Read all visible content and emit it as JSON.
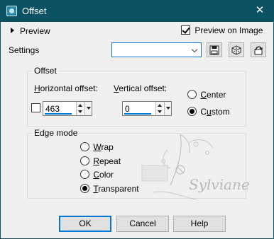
{
  "window": {
    "title": "Offset",
    "close_glyph": "✕",
    "icon": "psp-app-icon"
  },
  "header": {
    "preview_label": "Preview",
    "preview_on_image_label": "Preview on Image",
    "preview_on_image_checked": true
  },
  "settings": {
    "label": "Settings",
    "value": ""
  },
  "offset": {
    "group_label": "Offset",
    "horizontal": {
      "label_first": "H",
      "label_rest": "orizontal offset:",
      "value": "463"
    },
    "vertical": {
      "label_first": "V",
      "label_rest": "ertical offset:",
      "value": "0"
    },
    "link_checked": false,
    "center": {
      "label_first": "C",
      "label_rest": "enter",
      "selected": false
    },
    "custom": {
      "label_first": "",
      "label_u": "u",
      "label_rest": "stom",
      "label_pre": "C",
      "selected": true
    }
  },
  "edge_mode": {
    "group_label": "Edge mode",
    "options": [
      {
        "pre": "",
        "u": "W",
        "rest": "rap",
        "selected": false
      },
      {
        "pre": "",
        "u": "R",
        "rest": "epeat",
        "selected": false
      },
      {
        "pre": "",
        "u": "C",
        "rest": "olor",
        "selected": false
      },
      {
        "pre": "",
        "u": "T",
        "rest": "ransparent",
        "selected": true
      }
    ]
  },
  "watermark": {
    "text": "Sylviane"
  },
  "buttons": {
    "ok": "OK",
    "cancel": "Cancel",
    "help": "Help"
  },
  "colors": {
    "titlebar": "#0b5262",
    "focus": "#0078d7"
  }
}
